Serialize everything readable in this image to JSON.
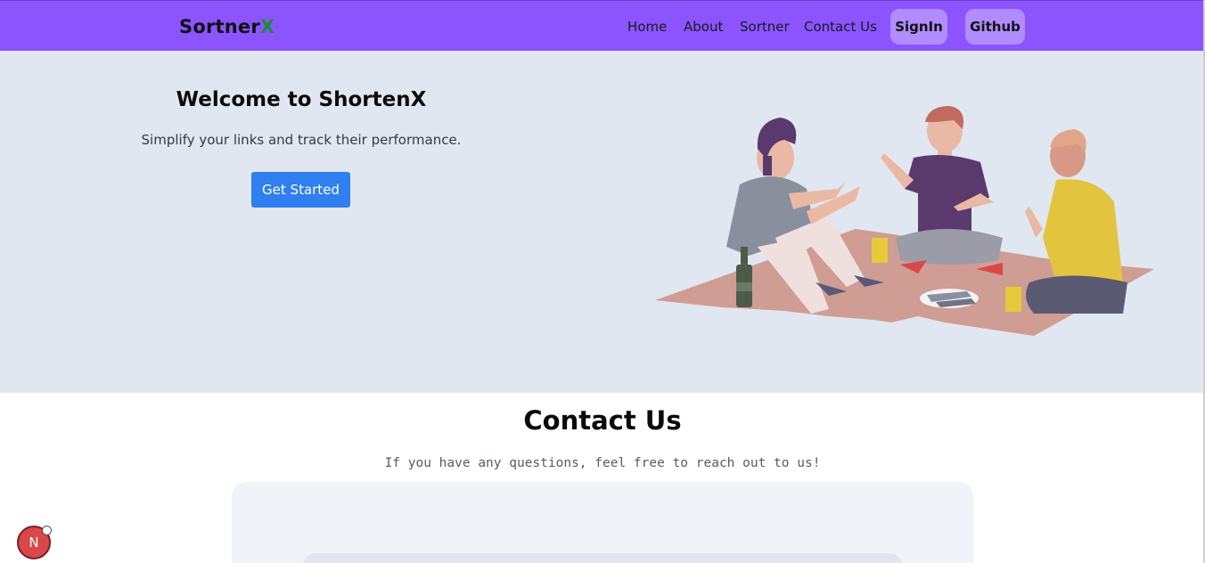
{
  "navbar": {
    "brand_main": "Sortner",
    "brand_accent": "X",
    "links": [
      "Home",
      "About",
      "Sortner",
      "Contact Us"
    ],
    "signin_label": "SignIn",
    "github_label": "Github"
  },
  "hero": {
    "title": "Welcome to ShortenX",
    "subtitle": "Simplify your links and track their performance.",
    "cta_label": "Get Started"
  },
  "contact": {
    "title": "Contact Us",
    "subtitle": "If you have any questions, feel free to reach out to us!"
  },
  "badge": {
    "label": "N"
  },
  "colors": {
    "navbar_bg": "#8b54ff",
    "nav_button_bg": "#b08cff",
    "brand_accent": "#1f8a3a",
    "hero_bg": "#e1e7f0",
    "cta_bg": "#2f7ff0",
    "card_bg": "#f0f3f8"
  }
}
